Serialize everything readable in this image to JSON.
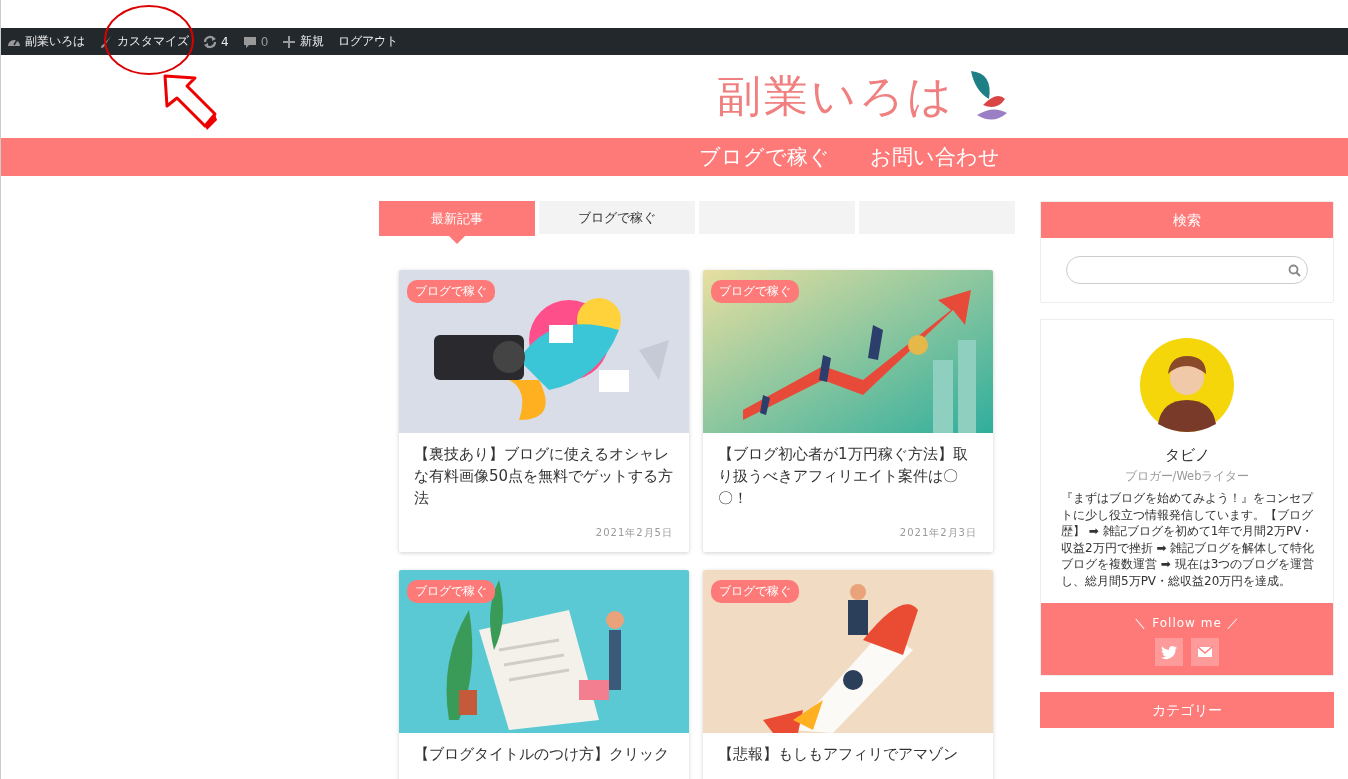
{
  "admin_bar": {
    "items": [
      {
        "kind": "dashboard",
        "label": "副業いろは"
      },
      {
        "kind": "customize",
        "label": "カスタマイズ"
      },
      {
        "kind": "updates",
        "label": "4"
      },
      {
        "kind": "comments",
        "label": "0"
      },
      {
        "kind": "new",
        "label": "新規"
      },
      {
        "kind": "logout",
        "label": "ログアウト"
      }
    ]
  },
  "site_title": "副業いろは",
  "nav": [
    "ブログで稼ぐ",
    "お問い合わせ"
  ],
  "tabs": [
    {
      "label": "最新記事",
      "selected": true
    },
    {
      "label": "ブログで稼ぐ",
      "selected": false
    },
    {
      "selected": false
    },
    {
      "selected": false
    }
  ],
  "posts": [
    {
      "category": "ブログで稼ぐ",
      "title": "【裏技あり】ブログに使えるオシャレな有料画像50点を無料でゲットする方法",
      "date": "2021年2月5日"
    },
    {
      "category": "ブログで稼ぐ",
      "title": "【ブログ初心者が1万円稼ぐ方法】取り扱うべきアフィリエイト案件は〇〇！",
      "date": "2021年2月3日"
    },
    {
      "category": "ブログで稼ぐ",
      "title": "【ブログタイトルのつけ方】クリック"
    },
    {
      "category": "ブログで稼ぐ",
      "title": "【悲報】もしもアフィリでアマゾン"
    }
  ],
  "sidebar": {
    "search": {
      "title": "検索"
    },
    "profile": {
      "name": "タビノ",
      "role": "ブロガー/Webライター",
      "bio": "『まずはブログを始めてみよう！』をコンセプトに少し役立つ情報発信しています。【ブログ歴】 ➡ 雑記ブログを初めて1年で月間2万PV・収益2万円で挫折 ➡ 雑記ブログを解体して特化ブログを複数運営 ➡ 現在は3つのブログを運営し、総月間5万PV・総収益20万円を達成。",
      "follow_label": "＼ Follow me ／",
      "social": [
        {
          "kind": "twitter"
        },
        {
          "kind": "mail"
        }
      ]
    },
    "categories": {
      "title": "カテゴリー"
    }
  },
  "annotations": [
    {
      "kind": "circle"
    },
    {
      "kind": "arrow"
    }
  ]
}
